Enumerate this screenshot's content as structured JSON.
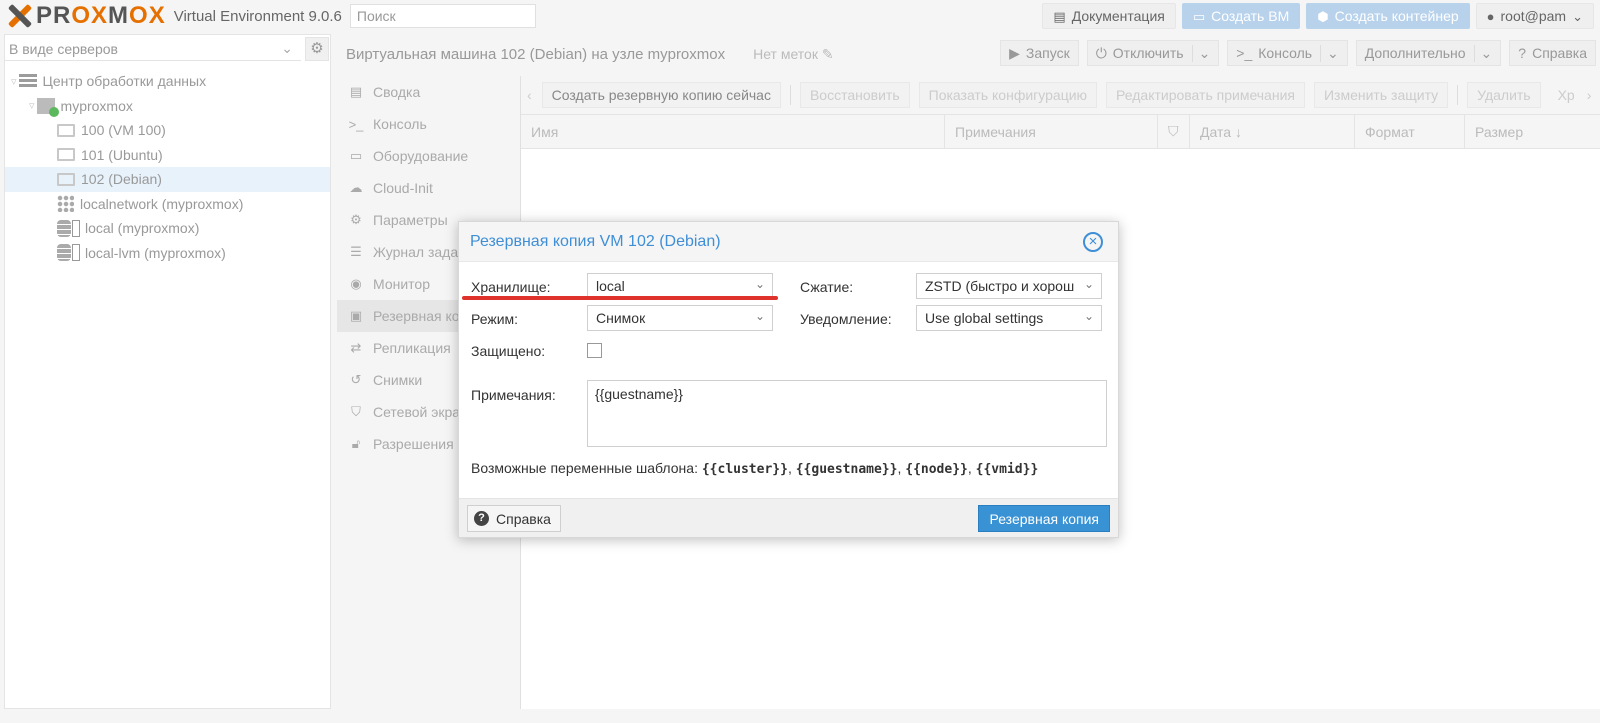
{
  "topbar": {
    "logo_prefix": "PR",
    "logo_ox1": "OX",
    "logo_m": "M",
    "logo_ox2": "OX",
    "version": "Virtual Environment 9.0.6",
    "search_placeholder": "Поиск",
    "docs": "Документация",
    "create_vm": "Создать ВМ",
    "create_ct": "Создать контейнер",
    "user": "root@pam"
  },
  "left": {
    "view": "В виде серверов",
    "tree": [
      {
        "label": "Центр обработки данных",
        "icon": "datacenter"
      },
      {
        "label": "myproxmox",
        "icon": "node"
      },
      {
        "label": "100 (VM 100)",
        "icon": "vm"
      },
      {
        "label": "101 (Ubuntu)",
        "icon": "vm"
      },
      {
        "label": "102 (Debian)",
        "icon": "vm"
      },
      {
        "label": "localnetwork (myproxmox)",
        "icon": "network"
      },
      {
        "label": "local (myproxmox)",
        "icon": "storage"
      },
      {
        "label": "local-lvm (myproxmox)",
        "icon": "storage"
      }
    ]
  },
  "header": {
    "title": "Виртуальная машина 102 (Debian) на узле myproxmox",
    "tags": "Нет меток",
    "start": "Запуск",
    "shutdown": "Отключить",
    "console": "Консоль",
    "more": "Дополнительно",
    "help": "Справка"
  },
  "submenu": [
    {
      "label": "Сводка",
      "icon": "book"
    },
    {
      "label": "Консоль",
      "icon": "terminal"
    },
    {
      "label": "Оборудование",
      "icon": "desktop"
    },
    {
      "label": "Cloud-Init",
      "icon": "cloud"
    },
    {
      "label": "Параметры",
      "icon": "gear"
    },
    {
      "label": "Журнал задач",
      "icon": "list"
    },
    {
      "label": "Монитор",
      "icon": "eye"
    },
    {
      "label": "Резервная копия",
      "icon": "floppy"
    },
    {
      "label": "Репликация",
      "icon": "retweet"
    },
    {
      "label": "Снимки",
      "icon": "history"
    },
    {
      "label": "Сетевой экран",
      "icon": "shield"
    },
    {
      "label": "Разрешения",
      "icon": "unlock"
    }
  ],
  "grid": {
    "toolbar": {
      "backup_now": "Создать резервную копию сейчас",
      "restore": "Восстановить",
      "show_config": "Показать конфигурацию",
      "edit_notes": "Редактировать примечания",
      "change_protection": "Изменить защиту",
      "delete": "Удалить",
      "storage_cut": "Хр"
    },
    "columns": [
      "Имя",
      "Примечания",
      "",
      "Дата",
      "Формат",
      "Размер"
    ]
  },
  "dialog": {
    "title": "Резервная копия VM 102 (Debian)",
    "storage_label": "Хранилище:",
    "storage_value": "local",
    "compression_label": "Сжатие:",
    "compression_value": "ZSTD (быстро и хорош",
    "mode_label": "Режим:",
    "mode_value": "Снимок",
    "notification_label": "Уведомление:",
    "notification_value": "Use global settings",
    "protected_label": "Защищено:",
    "notes_label": "Примечания:",
    "notes_value": "{{guestname}}",
    "vars_prefix": "Возможные переменные шаблона:",
    "vars": [
      "{{cluster}}",
      "{{guestname}}",
      "{{node}}",
      "{{vmid}}"
    ],
    "help": "Справка",
    "submit": "Резервная копия"
  },
  "colors": {
    "accent": "#3892d4",
    "brand_orange": "#e57000",
    "annotation_red": "#e0322c"
  }
}
